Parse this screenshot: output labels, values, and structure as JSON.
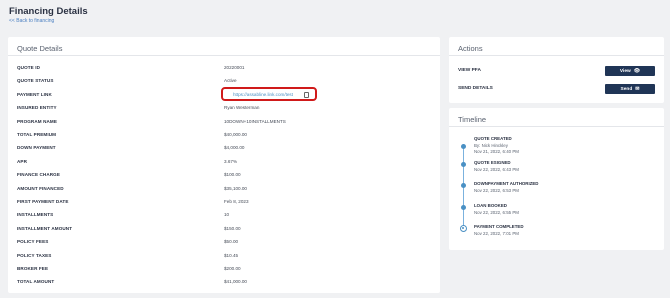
{
  "header": {
    "title": "Financing Details",
    "back_link": "<< Back to financing"
  },
  "quote_details": {
    "title": "Quote Details",
    "rows": [
      {
        "label": "QUOTE ID",
        "value": "20220001"
      },
      {
        "label": "QUOTE STATUS",
        "value": "Active"
      },
      {
        "label": "PAYMENT LINK",
        "value": "https://assabline.link.com/test"
      },
      {
        "label": "INSURED ENTITY",
        "value": "Ryan Westerman"
      },
      {
        "label": "PROGRAM NAME",
        "value": "10DOWN+10INSTALLMENTS"
      },
      {
        "label": "TOTAL PREMIUM",
        "value": "$40,000.00"
      },
      {
        "label": "DOWN PAYMENT",
        "value": "$4,000.00"
      },
      {
        "label": "APR",
        "value": "3.67%"
      },
      {
        "label": "FINANCE CHARGE",
        "value": "$100.00"
      },
      {
        "label": "AMOUNT FINANCED",
        "value": "$35,100.00"
      },
      {
        "label": "FIRST PAYMENT DATE",
        "value": "Feb 8, 2023"
      },
      {
        "label": "INSTALLMENTS",
        "value": "10"
      },
      {
        "label": "INSTALLMENT AMOUNT",
        "value": "$150.00"
      },
      {
        "label": "POLICY FEES",
        "value": "$50.00"
      },
      {
        "label": "POLICY TAXES",
        "value": "$10.45"
      },
      {
        "label": "BROKER FEE",
        "value": "$200.00"
      },
      {
        "label": "TOTAL AMOUNT",
        "value": "$41,000.00"
      }
    ]
  },
  "actions": {
    "title": "Actions",
    "items": [
      {
        "label": "VIEW PFA",
        "button": "View",
        "icon": "eye-icon"
      },
      {
        "label": "SEND DETAILS",
        "button": "Send",
        "icon": "mail-icon"
      }
    ]
  },
  "timeline": {
    "title": "Timeline",
    "events": [
      {
        "title": "QUOTE CREATED",
        "by": "By: Nick Hinckley",
        "date": "Nov 21, 2022, 6:40 PM"
      },
      {
        "title": "QUOTE ESIGNED",
        "by": "",
        "date": "Nov 22, 2022, 6:43 PM"
      },
      {
        "title": "DOWNPAYMENT AUTHORIZED",
        "by": "",
        "date": "Nov 22, 2022, 6:53 PM"
      },
      {
        "title": "LOAN BOOKED",
        "by": "",
        "date": "Nov 22, 2022, 6:55 PM"
      },
      {
        "title": "PAYMENT COMPLETED",
        "by": "",
        "date": "Nov 22, 2022, 7:01 PM"
      }
    ]
  },
  "colors": {
    "accent": "#203556",
    "link": "#4a90c4",
    "highlight": "#d01a1a"
  }
}
